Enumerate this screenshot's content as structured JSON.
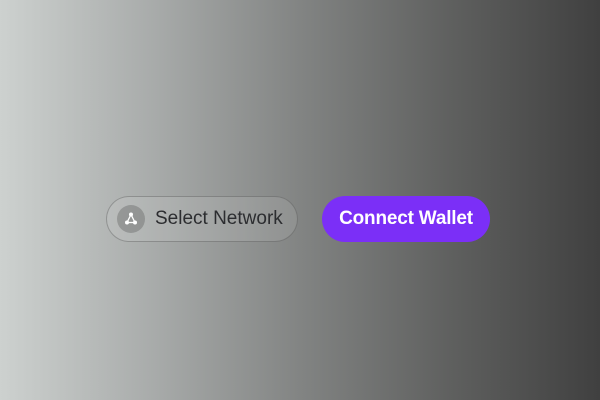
{
  "toolbar": {
    "network_button": {
      "label": "Select Network",
      "icon": "network-nodes-icon"
    },
    "wallet_button": {
      "label": "Connect Wallet"
    }
  },
  "colors": {
    "accent": "#7b2ff7",
    "background_start": "#cdd1cf",
    "background_end": "#404040"
  }
}
